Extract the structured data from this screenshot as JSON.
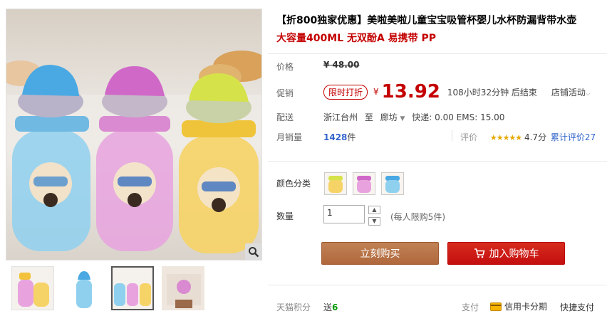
{
  "title": {
    "line1": "【折800独家优惠】美啦美啦儿童宝宝吸管杯婴儿水杯防漏背带水壶",
    "line2": "大容量400ML 无双酚A 易携带 PP"
  },
  "price": {
    "label": "价格",
    "original": "¥ 48.00"
  },
  "promo": {
    "label": "促销",
    "tag": "限时打折",
    "yen": "¥",
    "value": "13.92",
    "countdown": "108小时32分钟 后结束",
    "shop_activity": "店铺活动"
  },
  "shipping": {
    "label": "配送",
    "from": "浙江台州",
    "to_word": "至",
    "dest": "廊坊",
    "fees": "快递: 0.00 EMS: 15.00"
  },
  "sales": {
    "label": "月销量",
    "count": "1428",
    "unit": "件",
    "rating_label": "评价",
    "stars": "★★★★★",
    "score": "4.7分",
    "cumulative": "累计评价27"
  },
  "color": {
    "label": "颜色分类"
  },
  "quantity": {
    "label": "数量",
    "value": "1",
    "limit": "(每人限购5件)"
  },
  "buttons": {
    "buy_now": "立刻购买",
    "add_cart": "加入购物车"
  },
  "footer": {
    "points_label": "天猫积分",
    "points_prefix": "送",
    "points_value": "6",
    "pay_label": "支付",
    "installment": "信用卡分期",
    "quick_pay": "快捷支付"
  },
  "colors": {
    "accent": "#c40000",
    "buy_button": "#b96f42",
    "cart_button": "#c40f0f",
    "link": "#3366cc"
  },
  "icons": [
    "zoom-icon",
    "cart-icon",
    "credit-card-icon",
    "dropdown-arrow-icon",
    "chevron-down-icon"
  ]
}
